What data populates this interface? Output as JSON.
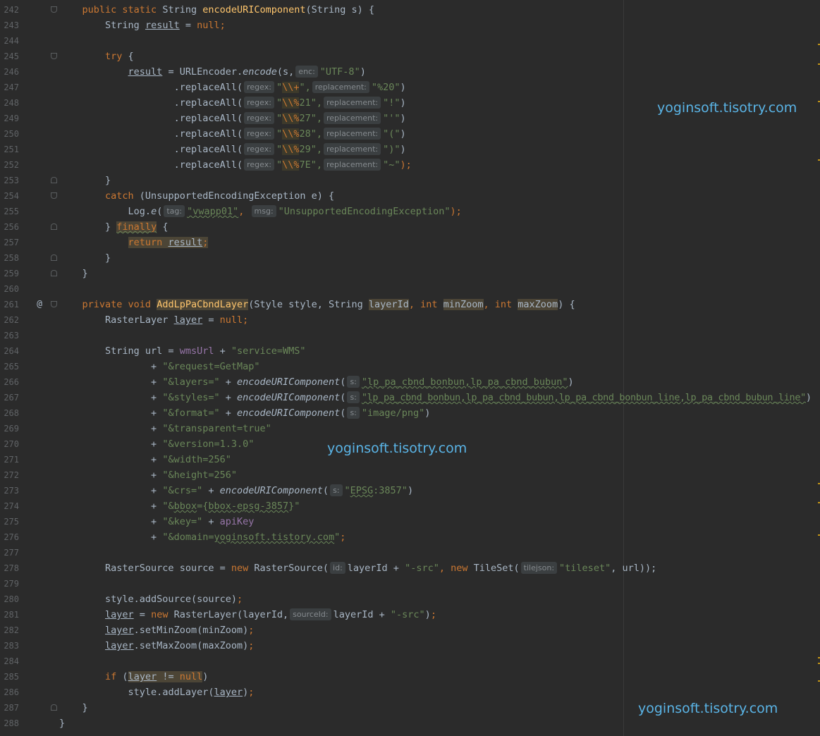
{
  "editor": {
    "language": "Java",
    "colors": {
      "background": "#2b2b2b",
      "keyword": "#cc7832",
      "method": "#ffc66d",
      "string": "#6a8759",
      "field": "#9876aa",
      "default_text": "#a9b7c6",
      "line_number": "#606366",
      "watermark": "#5ab4e6"
    },
    "gutter": {
      "line_numbers": [
        "242",
        "243",
        "244",
        "245",
        "246",
        "247",
        "248",
        "249",
        "250",
        "251",
        "252",
        "253",
        "254",
        "255",
        "256",
        "257",
        "258",
        "259",
        "260",
        "261",
        "262",
        "263",
        "264",
        "265",
        "266",
        "267",
        "268",
        "269",
        "270",
        "271",
        "272",
        "273",
        "274",
        "275",
        "276",
        "277",
        "278",
        "279",
        "280",
        "281",
        "282",
        "283",
        "284",
        "285",
        "286",
        "287",
        "288"
      ],
      "override_marker": "@"
    },
    "hints": {
      "enc": "enc:",
      "regex": "regex:",
      "replacement": "replacement:",
      "tag": "tag:",
      "msg": "msg:",
      "s": "s:",
      "id": "id:",
      "tilejson": "tilejson:",
      "sourceid": "sourceId:"
    },
    "code": {
      "l242": {
        "kw": "public static ",
        "type": "String ",
        "name": "encodeURIComponent",
        "params": "(String s) {"
      },
      "l243": {
        "a": "String ",
        "b": "result",
        "c": " = ",
        "d": "null",
        "e": ";"
      },
      "l245": {
        "a": "try",
        "b": " {"
      },
      "l246": {
        "a": "result",
        "b": " = URLEncoder.",
        "c": "encode",
        "d": "(s,",
        "e": "\"UTF-8\"",
        "f": ")"
      },
      "l247": {
        "a": ".replaceAll(",
        "b": "\"",
        "c": "\\\\+",
        "d": "\",",
        "e": "\"%20\"",
        "f": ")"
      },
      "l248": {
        "a": ".replaceAll(",
        "b": "\"",
        "c": "\\\\%",
        "d": "21\",",
        "e": "\"!\"",
        "f": ")"
      },
      "l249": {
        "a": ".replaceAll(",
        "b": "\"",
        "c": "\\\\%",
        "d": "27\",",
        "e": "\"'\"",
        "f": ")"
      },
      "l250": {
        "a": ".replaceAll(",
        "b": "\"",
        "c": "\\\\%",
        "d": "28\",",
        "e": "\"(\"",
        "f": ")"
      },
      "l251": {
        "a": ".replaceAll(",
        "b": "\"",
        "c": "\\\\%",
        "d": "29\",",
        "e": "\")\"",
        "f": ")"
      },
      "l252": {
        "a": ".replaceAll(",
        "b": "\"",
        "c": "\\\\%",
        "d": "7E\",",
        "e": "\"~\"",
        "f": ");"
      },
      "l253": {
        "a": "}"
      },
      "l254": {
        "a": "catch",
        "b": " (UnsupportedEncodingException e) {"
      },
      "l255": {
        "a": "Log.",
        "b": "e",
        "c": "(",
        "d": "\"vwapp01\"",
        "e": ", ",
        "f": "\"UnsupportedEncodingException\"",
        "g": ");"
      },
      "l256": {
        "a": "} ",
        "b": "finally",
        "c": " {"
      },
      "l257": {
        "a": "return ",
        "b": "result",
        "c": ";"
      },
      "l258": {
        "a": "}"
      },
      "l259": {
        "a": "}"
      },
      "l261": {
        "a": "private void ",
        "b": "AddLpPaCbndLayer",
        "c": "(Style style, String ",
        "d": "layerId",
        "e": ", ",
        "f": "int ",
        "g": "minZoom",
        "h": ", ",
        "i": "int ",
        "j": "maxZoom",
        "k": ") {"
      },
      "l262": {
        "a": "RasterLayer ",
        "b": "layer",
        "c": " = ",
        "d": "null",
        "e": ";"
      },
      "l264": {
        "a": "String url = ",
        "b": "wmsUrl",
        "c": " + ",
        "d": "\"service=WMS\""
      },
      "l265": {
        "a": "+ ",
        "b": "\"&request=GetMap\""
      },
      "l266": {
        "a": "+ ",
        "b": "\"&layers=\"",
        "c": " + ",
        "d": "encodeURIComponent",
        "e": "(",
        "f": "\"lp_pa_cbnd_bonbun,lp_pa_cbnd_bubun\"",
        "g": ")"
      },
      "l267": {
        "a": "+ ",
        "b": "\"&styles=\"",
        "c": " + ",
        "d": "encodeURIComponent",
        "e": "(",
        "f": "\"lp_pa_cbnd_bonbun,lp_pa_cbnd_bubun,lp_pa_cbnd_bonbun_line,lp_pa_cbnd_bubun_line\"",
        "g": ")"
      },
      "l268": {
        "a": "+ ",
        "b": "\"&format=\"",
        "c": " + ",
        "d": "encodeURIComponent",
        "e": "(",
        "f": "\"image/png\"",
        "g": ")"
      },
      "l269": {
        "a": "+ ",
        "b": "\"&transparent=true\""
      },
      "l270": {
        "a": "+ ",
        "b": "\"&version=1.3.0\""
      },
      "l271": {
        "a": "+ ",
        "b": "\"&width=256\""
      },
      "l272": {
        "a": "+ ",
        "b": "\"&height=256\""
      },
      "l273": {
        "a": "+ ",
        "b": "\"&crs=\"",
        "c": " + ",
        "d": "encodeURIComponent",
        "e": "(",
        "f": "\"",
        "g": "EPSG",
        "h": ":3857\"",
        "i": ")"
      },
      "l274": {
        "a": "+ ",
        "b": "\"&",
        "c": "bbox",
        "d": "={",
        "e": "bbox-epsg-3857",
        "f": "}\""
      },
      "l275": {
        "a": "+ ",
        "b": "\"&key=\"",
        "c": " + ",
        "d": "apiKey"
      },
      "l276": {
        "a": "+ ",
        "b": "\"&domain=",
        "c": "yoginsoft.tistory.com",
        "d": "\"",
        "e": ";"
      },
      "l278": {
        "a": "RasterSource source = ",
        "b": "new ",
        "c": "RasterSource(",
        "d": "layerId + ",
        "e": "\"-src\"",
        "f": ", ",
        "g": "new ",
        "h": "TileSet(",
        "i": "\"tileset\"",
        "j": ", url));"
      },
      "l280": {
        "a": "style.addSource(source)",
        "b": ";"
      },
      "l281": {
        "a": "layer",
        "b": " = ",
        "c": "new ",
        "d": "RasterLayer(layerId,",
        "e": "layerId + ",
        "f": "\"-src\"",
        "g": ")",
        "h": ";"
      },
      "l282": {
        "a": "layer",
        "b": ".setMinZoom(minZoom)",
        "c": ";"
      },
      "l283": {
        "a": "layer",
        "b": ".setMaxZoom(maxZoom)",
        "c": ";"
      },
      "l285": {
        "a": "if ",
        "b": "(",
        "c": "layer",
        "d": " != ",
        "e": "null",
        "f": ")"
      },
      "l286": {
        "a": "style.addLayer(",
        "b": "layer",
        "c": ")",
        "d": ";"
      },
      "l287": {
        "a": "}"
      },
      "l288": {
        "a": "}"
      }
    },
    "watermarks": [
      "yoginsoft.tisotry.com",
      "yoginsoft.tisotry.com",
      "yoginsoft.tisotry.com"
    ]
  }
}
